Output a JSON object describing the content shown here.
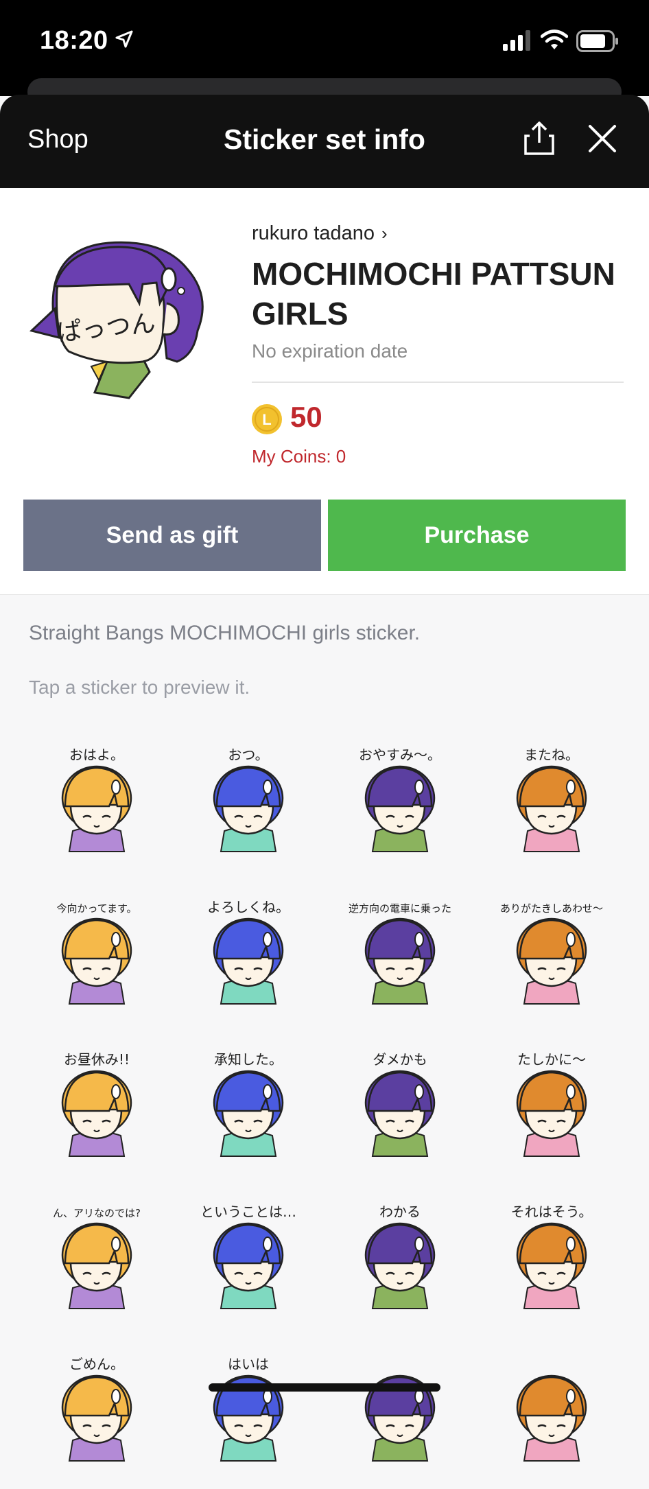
{
  "status_bar": {
    "time": "18:20"
  },
  "header": {
    "shop_label": "Shop",
    "title": "Sticker set info"
  },
  "sticker_set": {
    "author": "rukuro tadano",
    "title": "MOCHIMOCHI PATTSUN GIRLS",
    "expiry": "No expiration date",
    "price": "50",
    "my_coins": "My Coins: 0",
    "coin_letter": "L",
    "main_sticker_text": "ぱっつん"
  },
  "actions": {
    "gift_label": "Send as gift",
    "purchase_label": "Purchase"
  },
  "description": "Straight Bangs MOCHIMOCHI girls sticker.",
  "hint": "Tap a sticker to preview it.",
  "colors": {
    "purchase": "#4fb84d",
    "gift": "#6b7288",
    "price": "#c0282d",
    "coin": "#f2c12e"
  },
  "stickers": [
    {
      "text": "おはよ。",
      "hair": "#f5b94a",
      "outfit": "#b38ad6"
    },
    {
      "text": "おつ。",
      "hair": "#4a5be0",
      "outfit": "#7fd9c0"
    },
    {
      "text": "おやすみ〜。",
      "hair": "#5b3fa0",
      "outfit": "#8bb35e"
    },
    {
      "text": "またね。",
      "hair": "#e08a2e",
      "outfit": "#f0a6c0"
    },
    {
      "text": "今向かってます。",
      "hair": "#f5b94a",
      "outfit": "#b38ad6"
    },
    {
      "text": "よろしくね。",
      "hair": "#4a5be0",
      "outfit": "#7fd9c0"
    },
    {
      "text": "逆方向の電車に乗った",
      "hair": "#5b3fa0",
      "outfit": "#8bb35e"
    },
    {
      "text": "ありがたきしあわせ〜",
      "hair": "#e08a2e",
      "outfit": "#f0a6c0"
    },
    {
      "text": "お昼休み!!",
      "hair": "#f5b94a",
      "outfit": "#b38ad6"
    },
    {
      "text": "承知した。",
      "hair": "#4a5be0",
      "outfit": "#7fd9c0"
    },
    {
      "text": "ダメかも",
      "hair": "#5b3fa0",
      "outfit": "#8bb35e"
    },
    {
      "text": "たしかに〜",
      "hair": "#e08a2e",
      "outfit": "#f0a6c0"
    },
    {
      "text": "ん、アリなのでは?",
      "hair": "#f5b94a",
      "outfit": "#b38ad6"
    },
    {
      "text": "ということは…",
      "hair": "#4a5be0",
      "outfit": "#7fd9c0"
    },
    {
      "text": "わかる",
      "hair": "#5b3fa0",
      "outfit": "#8bb35e"
    },
    {
      "text": "それはそう。",
      "hair": "#e08a2e",
      "outfit": "#f0a6c0"
    },
    {
      "text": "ごめん。",
      "hair": "#f5b94a",
      "outfit": "#b38ad6"
    },
    {
      "text": "はいは",
      "hair": "#4a5be0",
      "outfit": "#7fd9c0"
    },
    {
      "text": "",
      "hair": "#5b3fa0",
      "outfit": "#8bb35e"
    },
    {
      "text": "",
      "hair": "#e08a2e",
      "outfit": "#f0a6c0"
    }
  ]
}
